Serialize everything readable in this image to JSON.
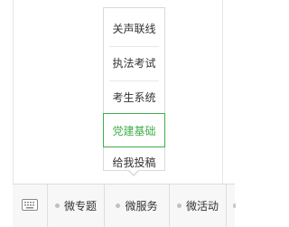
{
  "submenu": {
    "items": [
      "关声联线",
      "执法考试",
      "考生系统",
      "党建基础",
      "给我投稿"
    ],
    "active_index": 3
  },
  "menubar": {
    "keyboard_icon": "keyboard-icon",
    "items": [
      "微专题",
      "微服务",
      "微活动"
    ]
  },
  "colors": {
    "accent": "#3fae49",
    "bar_bg": "#f7f7f7",
    "border": "#d9d9d9"
  }
}
